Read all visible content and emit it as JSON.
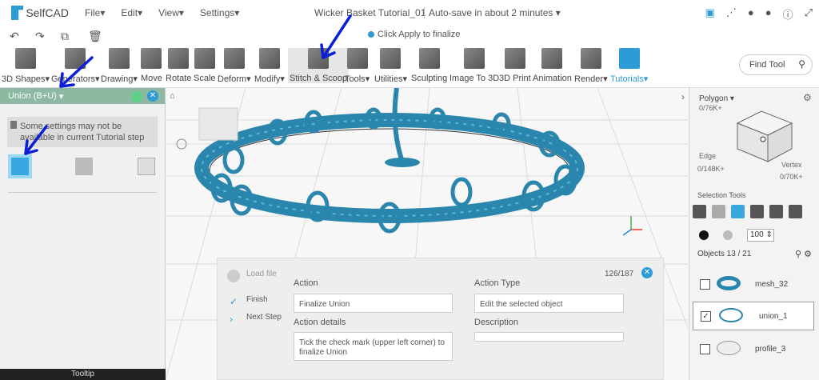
{
  "menubar": {
    "logo": "SelfCAD",
    "menus": [
      "File",
      "Edit",
      "View",
      "Settings"
    ],
    "doc_title": "Wicker Basket Tutorial_01",
    "autosave": "Auto-save in about 2 minutes"
  },
  "subbar": {
    "hint": "Click Apply to finalize"
  },
  "toolbar": {
    "tools": [
      "3D Shapes",
      "Generators",
      "Drawing",
      "Move",
      "Rotate",
      "Scale",
      "Deform",
      "Modify",
      "Stitch & Scoop",
      "Tools",
      "Utilities",
      "Sculpting",
      "Image To 3D",
      "3D Print",
      "Animation",
      "Render",
      "Tutorials"
    ],
    "find": "Find Tool"
  },
  "left": {
    "header": "Union (B+U)",
    "warning": "Some settings may not be available in current Tutorial step",
    "tooltip": "Tooltip"
  },
  "right": {
    "polygon": "Polygon",
    "polygon_count": "0/76K+",
    "edge": "Edge",
    "edge_count": "0/148K+",
    "vertex": "Vertex",
    "vertex_count": "0/70K+",
    "selection_tools": "Selection Tools",
    "size": "100",
    "objects": "Objects 13 / 21",
    "items": [
      {
        "name": "mesh_32",
        "checked": false
      },
      {
        "name": "union_1",
        "checked": true
      },
      {
        "name": "profile_3",
        "checked": false
      }
    ]
  },
  "tutorial": {
    "steps": [
      {
        "label": "Load file"
      },
      {
        "label": "Finish"
      },
      {
        "label": "Next Step"
      }
    ],
    "count": "126/187",
    "action_label": "Action",
    "action": "Finalize Union",
    "details_label": "Action details",
    "details": "Tick the check mark (upper left corner) to finalize Union",
    "type_label": "Action Type",
    "type": "Edit the selected object",
    "desc_label": "Description"
  },
  "colors": {
    "accent": "#2d9bd6",
    "model": "#2a86ad",
    "header": "#8db9a3",
    "annotation": "#0a1fd6"
  }
}
